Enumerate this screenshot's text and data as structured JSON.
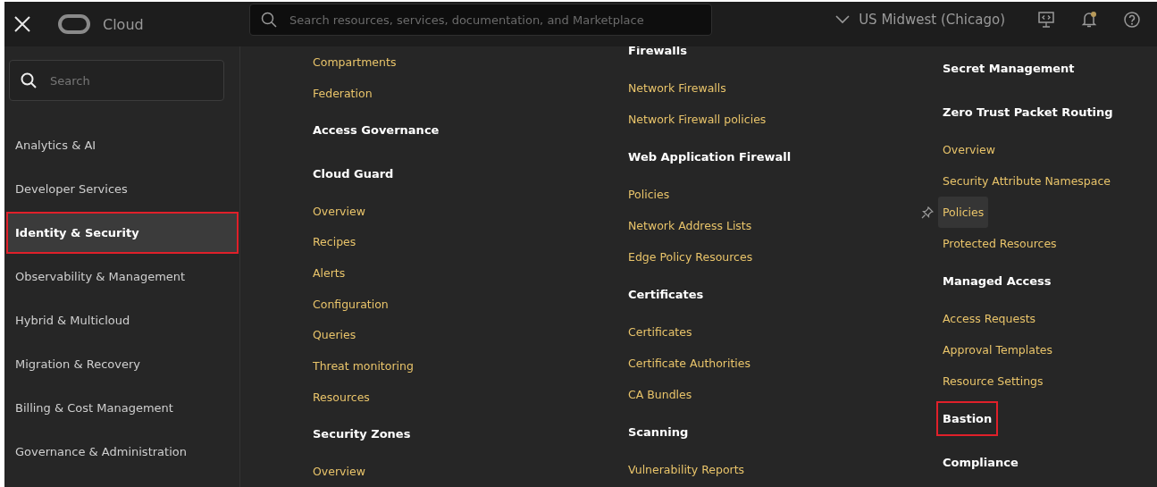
{
  "top_bar": {
    "brand": "Cloud",
    "search": {
      "placeholder": "Search resources, services, documentation, and Marketplace"
    },
    "region": "US Midwest (Chicago)",
    "notifications_unread": true
  },
  "sidebar": {
    "search": {
      "placeholder": "Search"
    },
    "items": [
      {
        "label": "Analytics & AI",
        "selected": false,
        "highlighted": false
      },
      {
        "label": "Developer Services",
        "selected": false,
        "highlighted": false
      },
      {
        "label": "Identity & Security",
        "selected": true,
        "highlighted": true
      },
      {
        "label": "Observability & Management",
        "selected": false,
        "highlighted": false
      },
      {
        "label": "Hybrid & Multicloud",
        "selected": false,
        "highlighted": false
      },
      {
        "label": "Migration & Recovery",
        "selected": false,
        "highlighted": false
      },
      {
        "label": "Billing & Cost Management",
        "selected": false,
        "highlighted": false
      },
      {
        "label": "Governance & Administration",
        "selected": false,
        "highlighted": false
      }
    ]
  },
  "columns": [
    [
      {
        "kind": "link",
        "label": "Compartments"
      },
      {
        "kind": "link",
        "label": "Federation"
      },
      {
        "kind": "heading",
        "label": "Access Governance"
      },
      {
        "kind": "heading",
        "label": "Cloud Guard"
      },
      {
        "kind": "link",
        "label": "Overview"
      },
      {
        "kind": "link",
        "label": "Recipes"
      },
      {
        "kind": "link",
        "label": "Alerts"
      },
      {
        "kind": "link",
        "label": "Configuration"
      },
      {
        "kind": "link",
        "label": "Queries"
      },
      {
        "kind": "link",
        "label": "Threat monitoring"
      },
      {
        "kind": "link",
        "label": "Resources"
      },
      {
        "kind": "heading",
        "label": "Security Zones"
      },
      {
        "kind": "link",
        "label": "Overview"
      }
    ],
    [
      {
        "kind": "heading",
        "label": "Firewalls"
      },
      {
        "kind": "link",
        "label": "Network Firewalls"
      },
      {
        "kind": "link",
        "label": "Network Firewall policies"
      },
      {
        "kind": "heading",
        "label": "Web Application Firewall"
      },
      {
        "kind": "link",
        "label": "Policies"
      },
      {
        "kind": "link",
        "label": "Network Address Lists"
      },
      {
        "kind": "link",
        "label": "Edge Policy Resources"
      },
      {
        "kind": "heading",
        "label": "Certificates"
      },
      {
        "kind": "link",
        "label": "Certificates"
      },
      {
        "kind": "link",
        "label": "Certificate Authorities"
      },
      {
        "kind": "link",
        "label": "CA Bundles"
      },
      {
        "kind": "heading",
        "label": "Scanning"
      },
      {
        "kind": "link",
        "label": "Vulnerability Reports"
      }
    ],
    [
      {
        "kind": "heading",
        "label": "Secret Management"
      },
      {
        "kind": "heading",
        "label": "Zero Trust Packet Routing"
      },
      {
        "kind": "link",
        "label": "Overview"
      },
      {
        "kind": "link",
        "label": "Security Attribute Namespace"
      },
      {
        "kind": "link",
        "label": "Policies",
        "hovered": true
      },
      {
        "kind": "link",
        "label": "Protected Resources"
      },
      {
        "kind": "heading",
        "label": "Managed Access"
      },
      {
        "kind": "link",
        "label": "Access Requests"
      },
      {
        "kind": "link",
        "label": "Approval Templates"
      },
      {
        "kind": "link",
        "label": "Resource Settings"
      },
      {
        "kind": "heading",
        "label": "Bastion",
        "highlighted": true
      },
      {
        "kind": "heading",
        "label": "Compliance"
      }
    ]
  ]
}
